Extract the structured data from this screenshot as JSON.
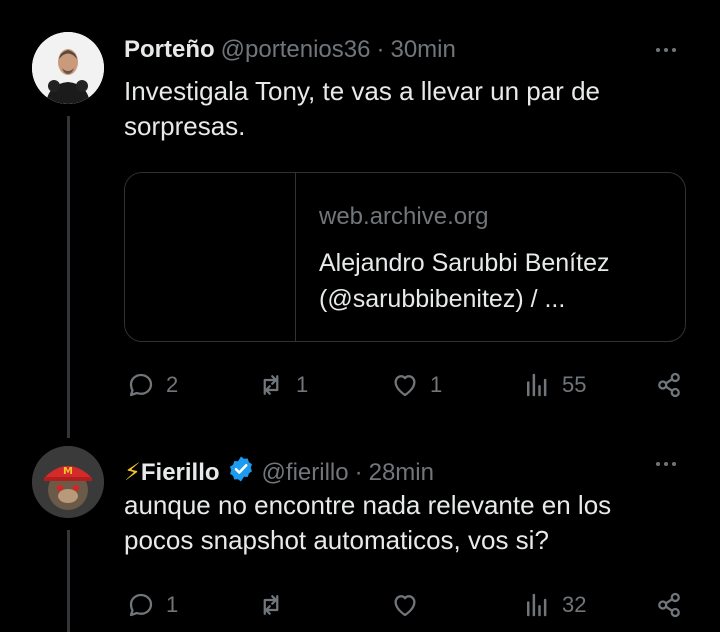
{
  "tweets": [
    {
      "display_name": "Porteño",
      "handle": "@portenios36",
      "separator": "·",
      "time": "30min",
      "text_line1": "Investigala Tony, te vas a llevar un par de",
      "text_line2": "sorpresas.",
      "link_card": {
        "domain": "web.archive.org",
        "title_line1": "Alejandro Sarubbi Benítez",
        "title_line2": "(@sarubbibenitez) / ..."
      },
      "actions": {
        "replies": "2",
        "retweets": "1",
        "likes": "1",
        "views": "55"
      }
    },
    {
      "display_name_prefix": "⚡",
      "display_name": "Fierillo",
      "verified": true,
      "handle": "@fierillo",
      "separator": "·",
      "time": "28min",
      "text_line1": "aunque no encontre nada relevante en los",
      "text_line2": "pocos snapshot automaticos, vos si?",
      "actions": {
        "replies": "1",
        "retweets": "",
        "likes": "",
        "views": "32"
      }
    }
  ],
  "colors": {
    "background": "#000000",
    "text": "#e7e9ea",
    "muted": "#71767b",
    "verified": "#1d9bf0",
    "bolt": "#f4c430"
  }
}
